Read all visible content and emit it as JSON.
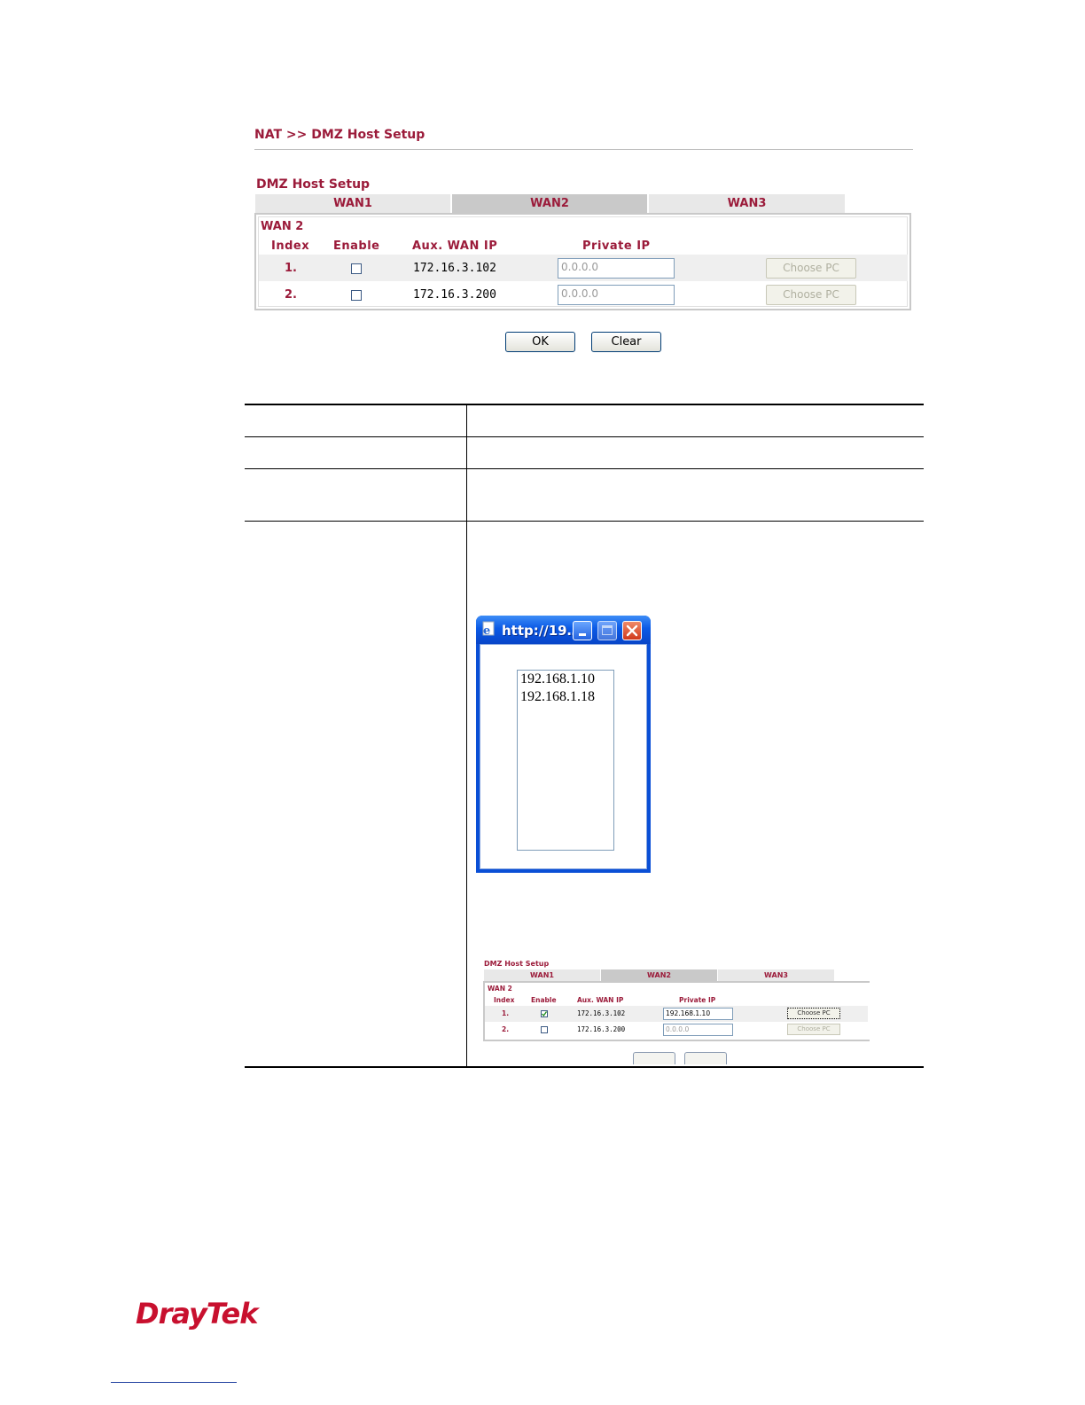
{
  "breadcrumb": "NAT >> DMZ Host Setup",
  "section_title": "DMZ Host Setup",
  "tabs": [
    {
      "label": "WAN1",
      "active": false
    },
    {
      "label": "WAN2",
      "active": true
    },
    {
      "label": "WAN3",
      "active": false
    }
  ],
  "panel": {
    "wan_label": "WAN 2",
    "headers": {
      "index": "Index",
      "enable": "Enable",
      "aux_wan_ip": "Aux. WAN IP",
      "private_ip": "Private IP"
    },
    "rows": [
      {
        "index": "1.",
        "enabled": false,
        "aux_wan_ip": "172.16.3.102",
        "private_ip": "0.0.0.0",
        "choose_label": "Choose PC"
      },
      {
        "index": "2.",
        "enabled": false,
        "aux_wan_ip": "172.16.3.200",
        "private_ip": "0.0.0.0",
        "choose_label": "Choose PC"
      }
    ]
  },
  "buttons": {
    "ok": "OK",
    "clear": "Clear"
  },
  "popup": {
    "title": "http://19…",
    "items": [
      "192.168.1.10",
      "192.168.1.18"
    ]
  },
  "mini": {
    "section_title": "DMZ Host Setup",
    "tabs": [
      "WAN1",
      "WAN2",
      "WAN3"
    ],
    "wan_label": "WAN 2",
    "headers": {
      "index": "Index",
      "enable": "Enable",
      "aux_wan_ip": "Aux. WAN IP",
      "private_ip": "Private IP"
    },
    "rows": [
      {
        "index": "1.",
        "enabled": true,
        "aux_wan_ip": "172.16.3.102",
        "private_ip": "192.168.1.10",
        "choose_label": "Choose PC"
      },
      {
        "index": "2.",
        "enabled": false,
        "aux_wan_ip": "172.16.3.200",
        "private_ip": "0.0.0.0",
        "choose_label": "Choose PC"
      }
    ]
  },
  "logo": "DrayTek",
  "colors": {
    "accent": "#9b1b3a",
    "logo": "#c8102e",
    "window_title": "#0b5ae6"
  }
}
